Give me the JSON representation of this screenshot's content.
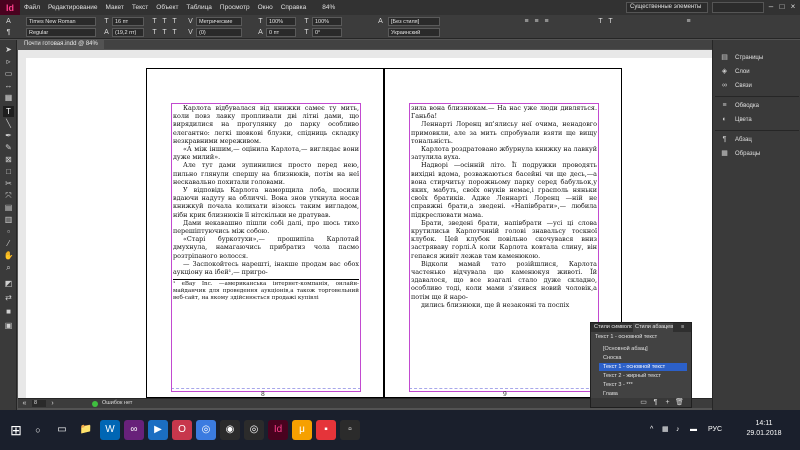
{
  "menubar": {
    "logo": "Id",
    "items": [
      "Файл",
      "Редактирование",
      "Макет",
      "Текст",
      "Объект",
      "Таблица",
      "Просмотр",
      "Окно",
      "Справка"
    ],
    "zoom": "84%",
    "workspace": "Существенные элементы"
  },
  "control": {
    "font_family": "Times New Roman",
    "font_style": "Regular",
    "font_size": "16 пт",
    "leading": "(19,2 пт)",
    "tracking": "(0)",
    "kerning": "Метрические",
    "scale_h": "100%",
    "scale_v": "100%",
    "baseline": "0 пт",
    "skew": "0°",
    "char_style": "[Без стиля]",
    "language": "Украинский"
  },
  "document": {
    "tab_title": "Почти готовая.indd @ 84%",
    "left_page_number": "8",
    "right_page_number": "9",
    "left_paragraphs": [
      "Карлота відбувалася від книжки самеє ту мить, коли повз лавку пропливали дві літні дами, що вирядилися на прогулянку до парку особливо елегантно: легкі шовкові блузки, спідниць складку незкравними мереживом.",
      "«А між іншим,— оцінила Карлота,— виглядає вони дуже милий».",
      "Але тут дами зупинилися просто перед нею, пильно глянули спершу на близнюків, потім на неї нескавально похитали головами.",
      "У відповідь Карлота наморщила лоба, шосили вдаючи надуту на обличчі. Вона знов уткнула носав книжкуй почала колихати візоксь таким вигладом, нібн крик близнюків її нітскільки не дратував.",
      "Дами некавашно пішли собі далі, про шось тихо перешіптуючись між собою.",
      "«Старі буркотухи»,— прошипіла Карлотай дмухнула, намагаючись прибратиз чола пасмо розтріпаного волосся.",
      "— Заспокойтесь нарешті, інакше продам вас обох аукціону на ібей¹,— пригро-"
    ],
    "left_footnote": "¹ eBay Inc. —американська інтернет-компанія, онлайн-майданчик для проведення аукціонів,а також торговельний веб-сайт, на якому здійснюється продажі купівлі",
    "right_paragraphs": [
      "зила вона близнюкам.— На нас уже люди дивляться. Ганьба!",
      "Леннарті Лоренц вп'ялисьу неї очима, ненадовго примовкли, але за мить спробували взяти ще вищу тональність.",
      "Карлота роздратовано жбурнула книжку на лавкуй затулила вуха.",
      "Надворі —осінній літо. Її подружки проводять вихідні вдома, розважаються басейні чи ще десь,—а вона стирчитьу порожньому парку серед бабульок,у яких, мабуть, своїх онуків немає,і граєполь няньки своїх братиків. Адже Леннарті Лоренц —ній не справжні брати,а зведені. «Напівбрати»,— любила підкреслювати мама.",
      "Брати, зведені брати, напівбрати —усі ці слова крутилисьв Карлотчиній голові знавальсу тоскної клубок. Цей клубок повільно скочувався вниз застряваву горлі.А коли Карлота ковтала слину, він гепався живіт лежав там каменюкою.",
      "Відколи мамай тато розійшлися, Карлота частенько відчувала цю каменюкуя животі. Їй здавалося, що все взагалі стало дуже складно, особливо тоді, коли мами з'явився новий чоловік,а потім ще й наро-",
      "дились близнюки, ще й незаконні та поспіх"
    ]
  },
  "status": {
    "page_field": "8",
    "errors": "Ошибок нет"
  },
  "dock": {
    "items": [
      "Страницы",
      "Слои",
      "Связи",
      "Обводка",
      "Цвета",
      "Абзац",
      "Образцы"
    ]
  },
  "styles_panel": {
    "tab_char": "Стили символов",
    "tab_para": "Стили абзацев",
    "current": "Текст 1 - основной текст",
    "items": [
      "[Основной абзац]",
      "Сноска",
      "Текст 1 - основной текст",
      "Текст 2 - жирный текст",
      "Текст 3 - ***",
      "Глава"
    ],
    "selected_index": 2
  },
  "taskbar": {
    "time": "14:11",
    "date": "29.01.2018",
    "lang": "РУС"
  },
  "colors": {
    "frame_accent": "#c24ad0",
    "selection": "#2c60c8",
    "app_brand": "#ff3d8c"
  }
}
